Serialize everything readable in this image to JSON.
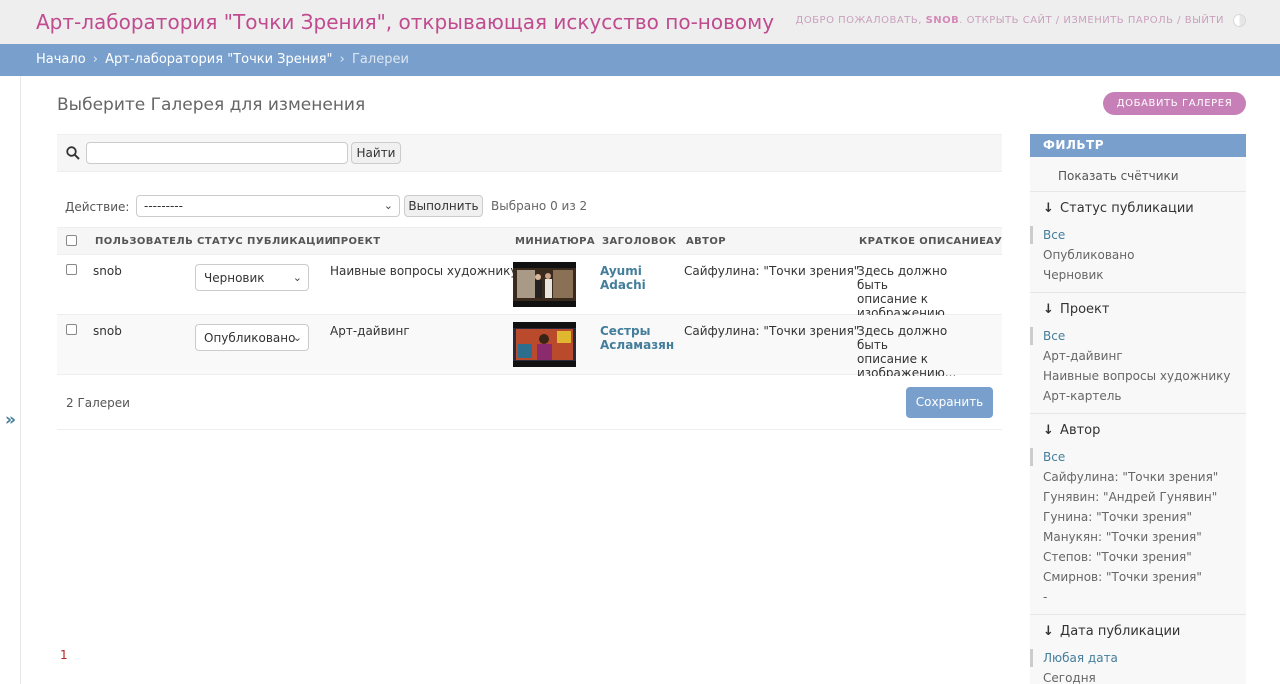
{
  "header": {
    "site_title": "Арт-лаборатория \"Точки Зрения\", открывающая искусство по-новому",
    "welcome": "Добро пожаловать,",
    "username": "snob",
    "view_site": "Открыть сайт",
    "change_password": "Изменить пароль",
    "logout": "Выйти"
  },
  "breadcrumbs": {
    "home": "Начало",
    "app": "Арт-лаборатория \"Точки Зрения\"",
    "current": "Галереи",
    "separator": "›"
  },
  "nav_toggle": "»",
  "page": {
    "title": "Выберите Галерея для изменения",
    "add_button": "Добавить Галерея"
  },
  "search": {
    "value": "",
    "button": "Найти"
  },
  "actions": {
    "label": "Действие:",
    "selected": "---------",
    "go_button": "Выполнить",
    "counter": "Выбрано 0 из 2"
  },
  "table": {
    "columns": [
      "Пользователь",
      "Статус публикации",
      "Проект",
      "Миниатюра",
      "Заголовок",
      "Автор",
      "Краткое описание",
      "Ауд"
    ],
    "rows": [
      {
        "user": "snob",
        "status": "Черновик",
        "project": "Наивные вопросы художнику",
        "title_line1": "Ayumi",
        "title_line2": "Adachi",
        "author": "Сайфулина: \"Точки зрения\"",
        "desc_line1": "Здесь должно быть",
        "desc_line2": "описание к",
        "desc_line3": "изображению..."
      },
      {
        "user": "snob",
        "status": "Опубликовано",
        "project": "Арт-дайвинг",
        "title_line1": "Сестры",
        "title_line2": "Асламазян",
        "author": "Сайфулина: \"Точки зрения\"",
        "desc_line1": "Здесь должно быть",
        "desc_line2": "описание к",
        "desc_line3": "изображению..."
      }
    ]
  },
  "footer": {
    "result_count": "2 Галереи",
    "save_button": "Сохранить"
  },
  "pagination": {
    "current_page": "1"
  },
  "filter": {
    "header": "Фильтр",
    "show_counts": "Показать счётчики",
    "arrow": "↓",
    "groups": [
      {
        "title": "Статус публикации",
        "items": [
          "Все",
          "Опубликовано",
          "Черновик"
        ]
      },
      {
        "title": "Проект",
        "items": [
          "Все",
          "Арт-дайвинг",
          "Наивные вопросы художнику",
          "Арт-картель"
        ]
      },
      {
        "title": "Автор",
        "items": [
          "Все",
          "Сайфулина: \"Точки зрения\"",
          "Гунявин: \"Андрей Гунявин\"",
          "Гунина: \"Точки зрения\"",
          "Манукян: \"Точки зрения\"",
          "Степов: \"Точки зрения\"",
          "Смирнов: \"Точки зрения\"",
          "-"
        ]
      },
      {
        "title": "Дата публикации",
        "items": [
          "Любая дата",
          "Сегодня"
        ]
      }
    ]
  },
  "colors": {
    "brand_title": "#c04b8f",
    "breadcrumb_bar": "#79a0cd",
    "link": "#447e9b",
    "add_button": "#c77fb7"
  }
}
